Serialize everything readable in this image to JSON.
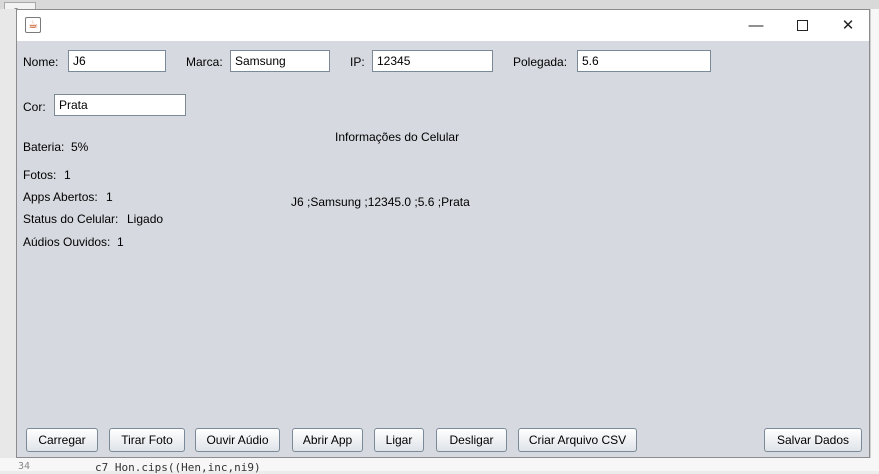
{
  "background": {
    "tab_letter": "S",
    "line_no": "34",
    "code_snippet": "c7          Hon.cips((Hen,inc,ni9)"
  },
  "window": {
    "icon": "java-cup-icon",
    "controls": {
      "minimize": "—",
      "maximize": "",
      "close": "✕"
    }
  },
  "form": {
    "nome": {
      "label": "Nome:",
      "value": "J6"
    },
    "marca": {
      "label": "Marca:",
      "value": "Samsung"
    },
    "ip": {
      "label": "IP:",
      "value": "12345"
    },
    "polegada": {
      "label": "Polegada:",
      "value": "5.6"
    },
    "cor": {
      "label": "Cor:",
      "value": "Prata"
    }
  },
  "info": {
    "title": "Informações do Celular",
    "summary": "J6 ;Samsung ;12345.0 ;5.6 ;Prata",
    "bateria": {
      "label": "Bateria:",
      "value": "5%"
    },
    "fotos": {
      "label": "Fotos:",
      "value": "1"
    },
    "apps_abertos": {
      "label": "Apps Abertos:",
      "value": "1"
    },
    "status": {
      "label": "Status do Celular:",
      "value": "Ligado"
    },
    "audios": {
      "label": "Aúdios Ouvidos:",
      "value": "1"
    }
  },
  "buttons": {
    "carregar": "Carregar",
    "tirar_foto": "Tirar Foto",
    "ouvir_audio": "Ouvir Aúdio",
    "abrir_app": "Abrir App",
    "ligar": "Ligar",
    "desligar": "Desligar",
    "criar_csv": "Criar Arquivo CSV",
    "salvar": "Salvar Dados"
  },
  "colors": {
    "window_bg": "#d6d9df",
    "titlebar_bg": "#ffffff",
    "field_border": "#7a8a99"
  }
}
